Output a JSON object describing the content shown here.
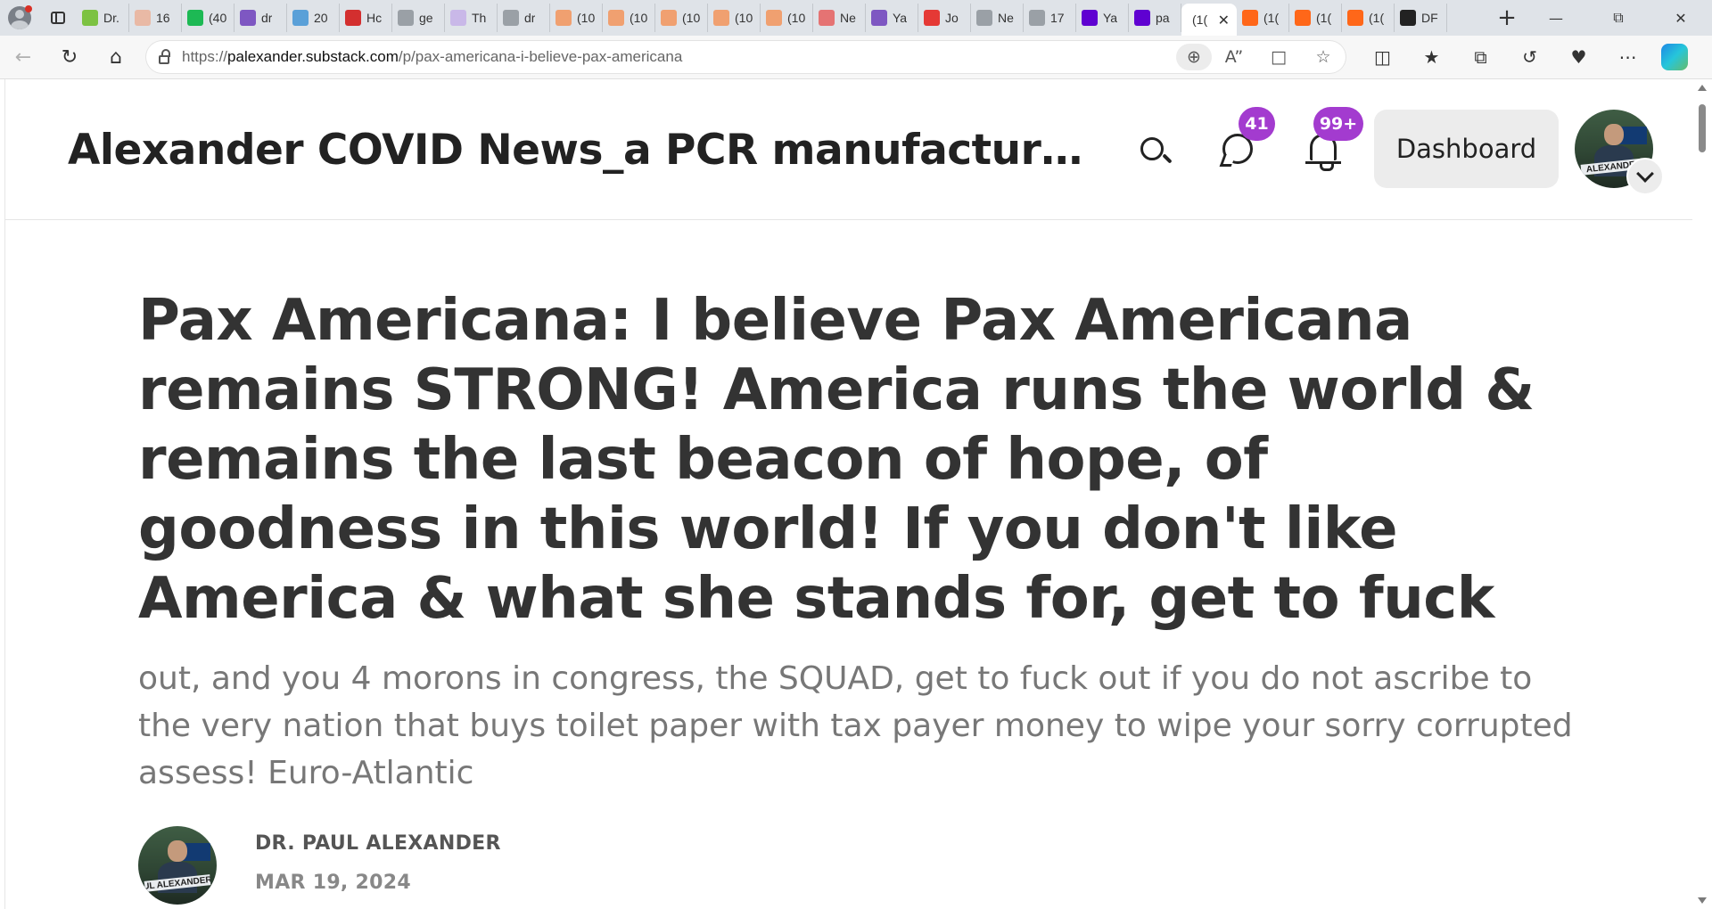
{
  "browser": {
    "tabs": [
      {
        "label": "Dr.",
        "icon": "video-play-icon",
        "color": "#7cc242"
      },
      {
        "label": "16",
        "icon": "bi-icon",
        "color": "#e9b9a5"
      },
      {
        "label": "(40",
        "icon": "g-logo-icon",
        "color": "#1db954"
      },
      {
        "label": "dr",
        "icon": "yahoo-icon",
        "color": "#7e57c2"
      },
      {
        "label": "20",
        "icon": "p-logo-icon",
        "color": "#5aa0d8"
      },
      {
        "label": "Hc",
        "icon": "news-icon",
        "color": "#d32f2f"
      },
      {
        "label": "ge",
        "icon": "search-icon",
        "color": "#9aa0a6"
      },
      {
        "label": "Th",
        "icon": "ds-icon",
        "color": "#c9b8e8"
      },
      {
        "label": "dr",
        "icon": "translate-icon",
        "color": "#9aa0a6"
      },
      {
        "label": "(10",
        "icon": "substack-icon",
        "color": "#f0a070"
      },
      {
        "label": "(10",
        "icon": "substack-icon",
        "color": "#f0a070"
      },
      {
        "label": "(10",
        "icon": "substack-icon",
        "color": "#f0a070"
      },
      {
        "label": "(10",
        "icon": "substack-icon",
        "color": "#f0a070"
      },
      {
        "label": "(10",
        "icon": "substack-icon",
        "color": "#f0a070"
      },
      {
        "label": "Ne",
        "icon": "r-logo-icon",
        "color": "#e57373"
      },
      {
        "label": "Ya",
        "icon": "yahoo-icon",
        "color": "#7e57c2"
      },
      {
        "label": "Jo",
        "icon": "youtube-icon",
        "color": "#e53935"
      },
      {
        "label": "Ne",
        "icon": "page-icon",
        "color": "#9aa0a6"
      },
      {
        "label": "17",
        "icon": "translate-icon",
        "color": "#9aa0a6"
      },
      {
        "label": "Ya",
        "icon": "yahoo-icon",
        "color": "#5f01d1"
      },
      {
        "label": "pa",
        "icon": "yahoo-icon",
        "color": "#5f01d1"
      },
      {
        "label": "(1(",
        "icon": "",
        "color": "",
        "active": true
      },
      {
        "label": "(1(",
        "icon": "substack-icon",
        "color": "#ff6719"
      },
      {
        "label": "(1(",
        "icon": "substack-icon",
        "color": "#ff6719"
      },
      {
        "label": "(1(",
        "icon": "substack-icon",
        "color": "#ff6719"
      },
      {
        "label": "DF",
        "icon": "df-logo-icon",
        "color": "#222222"
      }
    ],
    "url_prefix": "https://",
    "url_host": "palexander.substack.com",
    "url_path": "/p/pax-americana-i-believe-pax-americana"
  },
  "site": {
    "title": "Alexander COVID News_a PCR manufactured…",
    "chat_badge": "41",
    "notif_badge": "99+",
    "dashboard_label": "Dashboard",
    "accent_color": "#a33bcf"
  },
  "post": {
    "title": "Pax Americana: I believe Pax Americana remains STRONG! America runs the world & remains the last beacon of hope, of goodness in this world! If you don't like America & what she stands for, get to fuck",
    "subtitle": "out, and you 4 morons in congress, the SQUAD, get to fuck out if you do not ascribe to the very nation that buys toilet paper with tax payer money to wipe your sorry corrupted assess! Euro-Atlantic",
    "author": "DR. PAUL ALEXANDER",
    "date": "MAR 19, 2024"
  }
}
